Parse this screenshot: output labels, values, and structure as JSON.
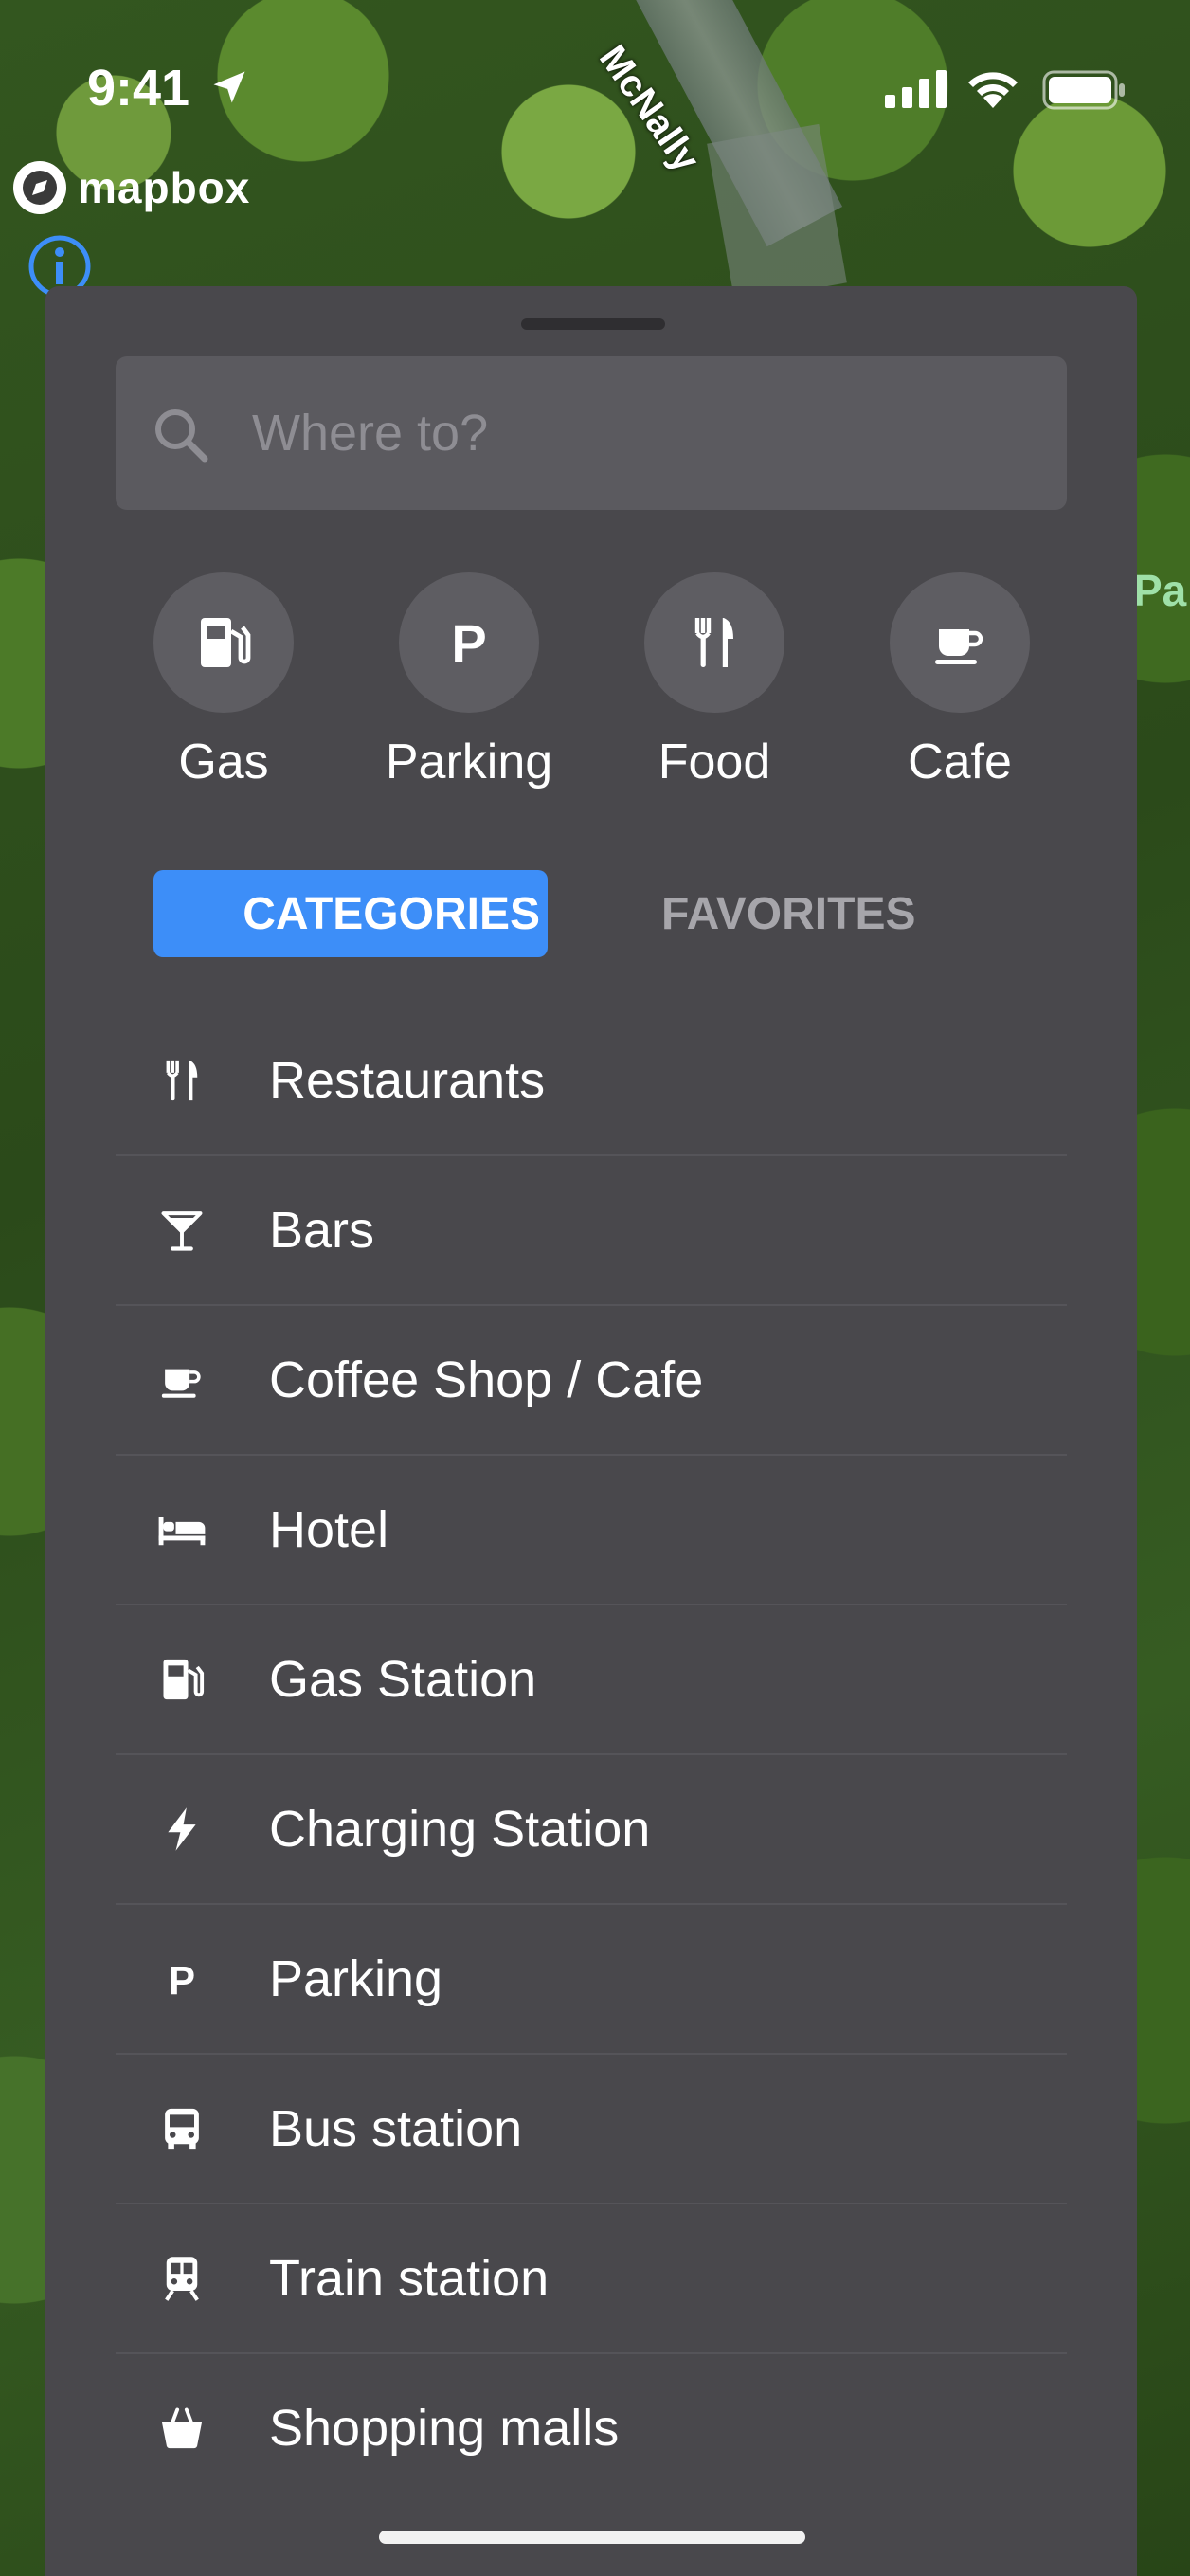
{
  "map": {
    "road_label": "McNally",
    "park_label": "Pa",
    "attribution": "mapbox"
  },
  "status_bar": {
    "time": "9:41"
  },
  "sheet": {
    "search": {
      "placeholder": "Where to?",
      "value": ""
    },
    "quick_actions": [
      {
        "label": "Gas",
        "icon": "gas-pump-icon"
      },
      {
        "label": "Parking",
        "icon": "parking-icon"
      },
      {
        "label": "Food",
        "icon": "fork-knife-icon"
      },
      {
        "label": "Cafe",
        "icon": "coffee-cup-icon"
      }
    ],
    "tabs": {
      "categories": "CATEGORIES",
      "favorites": "FAVORITES",
      "active": "categories"
    },
    "categories": [
      {
        "label": "Restaurants",
        "icon": "fork-knife-icon"
      },
      {
        "label": "Bars",
        "icon": "cocktail-icon"
      },
      {
        "label": "Coffee Shop / Cafe",
        "icon": "coffee-cup-icon"
      },
      {
        "label": "Hotel",
        "icon": "bed-icon"
      },
      {
        "label": "Gas Station",
        "icon": "gas-pump-icon"
      },
      {
        "label": "Charging Station",
        "icon": "lightning-icon"
      },
      {
        "label": "Parking",
        "icon": "parking-icon"
      },
      {
        "label": "Bus station",
        "icon": "bus-icon"
      },
      {
        "label": "Train station",
        "icon": "train-icon"
      },
      {
        "label": "Shopping malls",
        "icon": "shopping-basket-icon"
      }
    ]
  },
  "colors": {
    "sheet_bg": "#49484c",
    "accent": "#3d8ef8",
    "search_bg": "#5b5a5f",
    "circle_bg": "#5e5d62"
  }
}
